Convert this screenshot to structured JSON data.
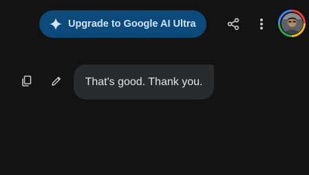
{
  "header": {
    "upgrade_label": "Upgrade to Google AI Ultra",
    "spark_icon": "gemini-spark-icon",
    "share_icon": "share-icon",
    "more_icon": "more-vert-icon",
    "avatar_icon": "user-avatar"
  },
  "message": {
    "text": "That's good. Thank you.",
    "actions": [
      "copy-icon",
      "edit-icon"
    ]
  },
  "colors": {
    "background": "#131314",
    "upgrade_button": "#0b4a7a",
    "upgrade_text": "#d3e3fd",
    "bubble": "#2a2b2d",
    "text": "#e3e3e3",
    "icon": "#c4c7c5"
  }
}
